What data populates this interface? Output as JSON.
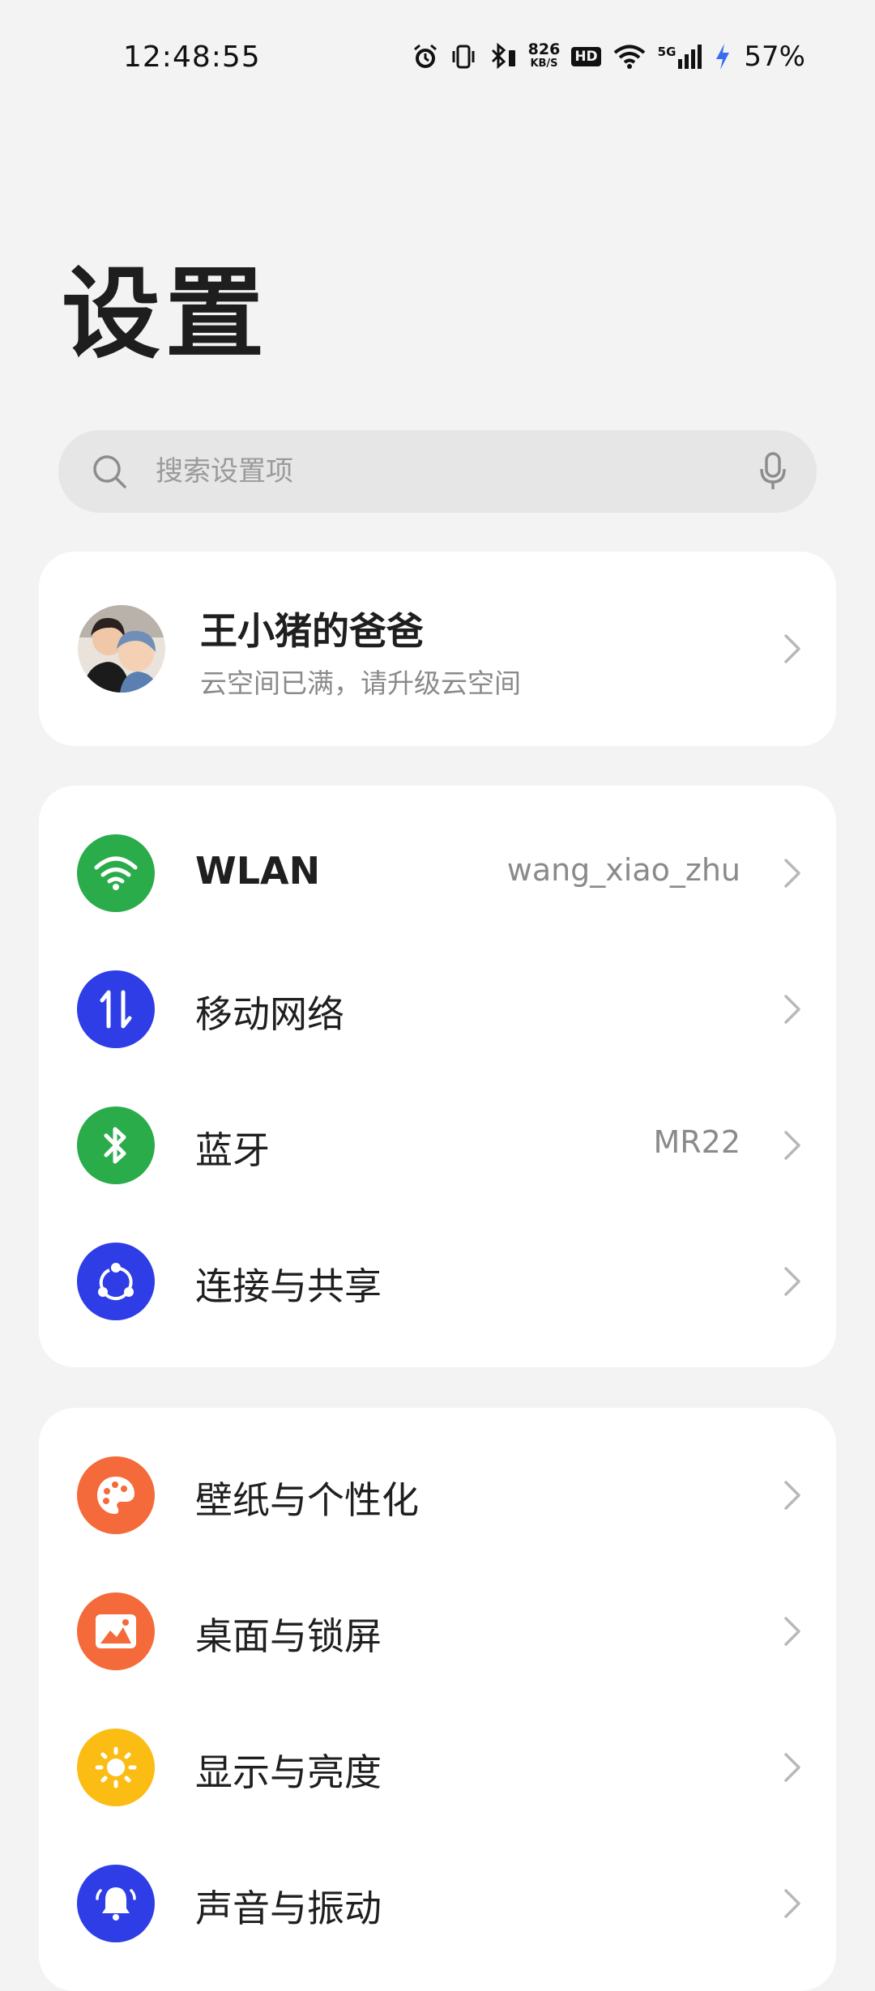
{
  "status_bar": {
    "time": "12:48:55",
    "net_speed_value": "826",
    "net_speed_unit": "KB/S",
    "hd_badge": "HD",
    "network_type": "5G",
    "battery_percent": "57%",
    "icons": [
      "alarm-icon",
      "vibrate-icon",
      "bluetooth-battery-icon",
      "hd-icon",
      "wifi-icon",
      "cellular-signal-icon",
      "charging-icon"
    ]
  },
  "header": {
    "title": "设置"
  },
  "search": {
    "placeholder": "搜索设置项",
    "value": ""
  },
  "account": {
    "name": "王小猪的爸爸",
    "subtitle": "云空间已满，请升级云空间"
  },
  "network_group": [
    {
      "label": "WLAN",
      "value": "wang_xiao_zhu",
      "icon": "wifi-icon",
      "color": "#2bac4b"
    },
    {
      "label": "移动网络",
      "value": "",
      "icon": "mobile-data-icon",
      "color": "#2e3de6"
    },
    {
      "label": "蓝牙",
      "value": "MR22",
      "icon": "bluetooth-icon",
      "color": "#2bac4b"
    },
    {
      "label": "连接与共享",
      "value": "",
      "icon": "share-icon",
      "color": "#2e3de6"
    }
  ],
  "personal_group": [
    {
      "label": "壁纸与个性化",
      "icon": "palette-icon",
      "color": "#f46a3a"
    },
    {
      "label": "桌面与锁屏",
      "icon": "picture-icon",
      "color": "#f46a3a"
    },
    {
      "label": "显示与亮度",
      "icon": "sun-icon",
      "color": "#fbbd14"
    },
    {
      "label": "声音与振动",
      "icon": "bell-icon",
      "color": "#2e3de6"
    }
  ]
}
